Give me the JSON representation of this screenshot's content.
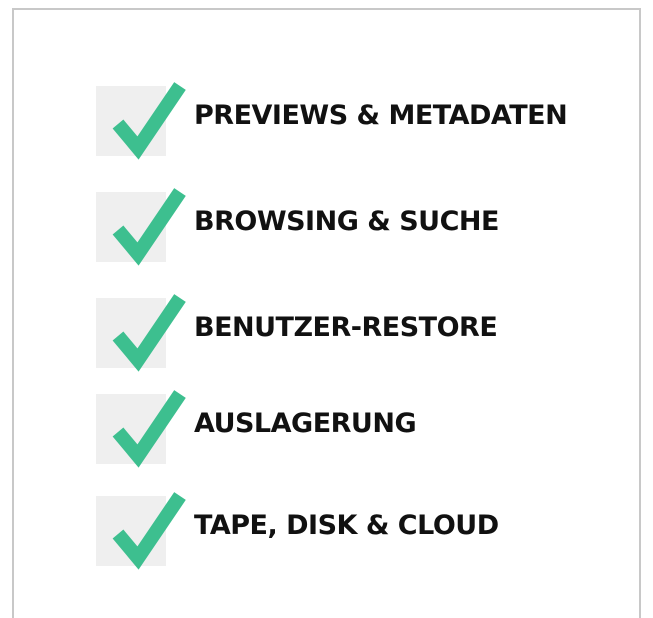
{
  "accent_color": "#3dbf8f",
  "icon": "checkmark-icon",
  "features": [
    {
      "label": "PREVIEWS & METADATEN"
    },
    {
      "label": "BROWSING & SUCHE"
    },
    {
      "label": "BENUTZER-RESTORE"
    },
    {
      "label": "AUSLAGERUNG"
    },
    {
      "label": "TAPE, DISK & CLOUD"
    }
  ]
}
